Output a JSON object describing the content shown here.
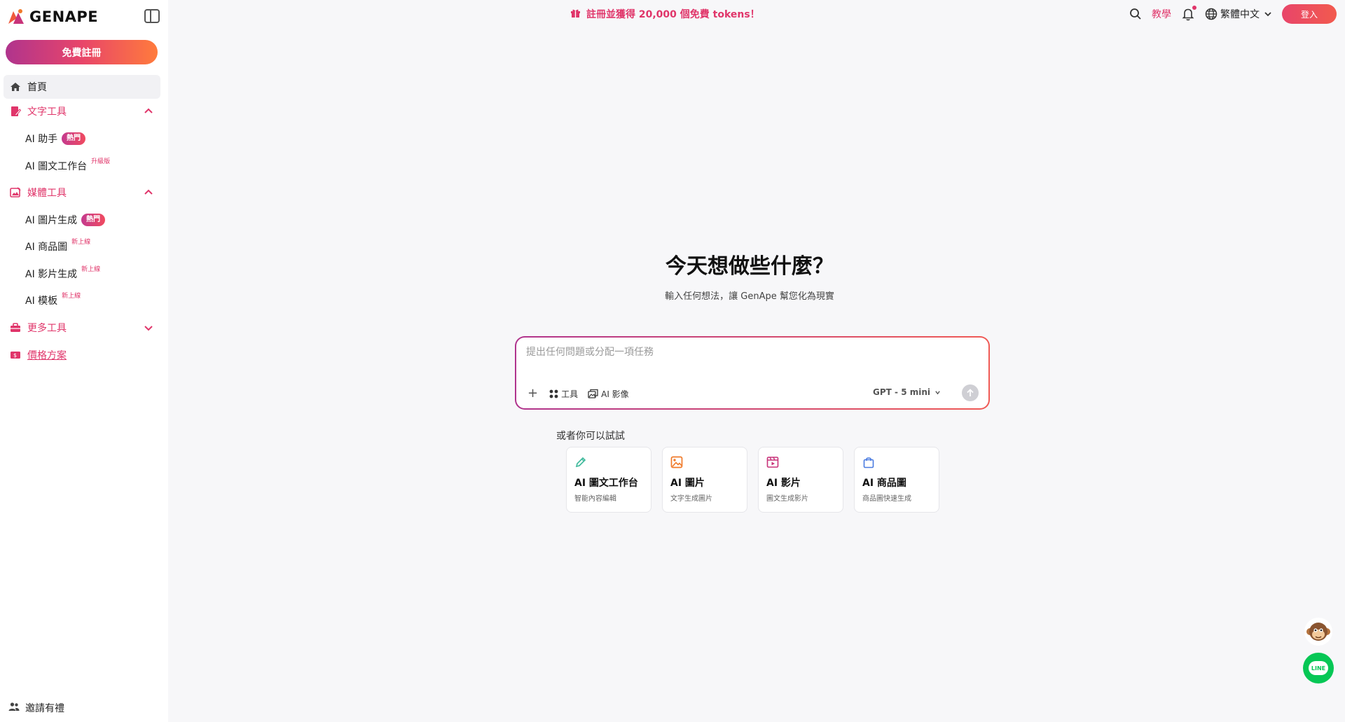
{
  "brand": {
    "name": "GENAPE",
    "accent": "#e0356a"
  },
  "sidebar": {
    "signup_label": "免費註冊",
    "home_label": "首頁",
    "sections": [
      {
        "label": "文字工具",
        "expanded": true,
        "items": [
          {
            "label": "AI 助手",
            "badge": "熱門",
            "badge_type": "hot"
          },
          {
            "label": "AI 圖文工作台",
            "badge": "升級版",
            "badge_type": "sup"
          }
        ]
      },
      {
        "label": "媒體工具",
        "expanded": true,
        "items": [
          {
            "label": "AI 圖片生成",
            "badge": "熱門",
            "badge_type": "hot"
          },
          {
            "label": "AI 商品圖",
            "badge": "新上線",
            "badge_type": "sup"
          },
          {
            "label": "AI 影片生成",
            "badge": "新上線",
            "badge_type": "sup"
          },
          {
            "label": "AI 模板",
            "badge": "新上線",
            "badge_type": "sup"
          }
        ]
      },
      {
        "label": "更多工具",
        "expanded": false,
        "items": []
      }
    ],
    "pricing_label": "價格方案",
    "invite_label": "邀請有禮"
  },
  "topbar": {
    "promo_text": "註冊並獲得 20,000 個免費 tokens！",
    "tutorial_label": "教學",
    "language": "繁體中文",
    "login_label": "登入"
  },
  "main": {
    "headline": "今天想做些什麼？",
    "subline": "輸入任何想法，讓 GenApe 幫您化為現實",
    "prompt_placeholder": "提出任何問題或分配一項任務",
    "tools_label": "工具",
    "ai_image_label": "AI 影像",
    "model": "GPT - 5 mini",
    "try_label": "或者你可以試試",
    "cards": [
      {
        "title": "AI 圖文工作台",
        "subtitle": "智能內容編輯",
        "icon": "pencil-icon",
        "color": "#3bb89a"
      },
      {
        "title": "AI 圖片",
        "subtitle": "文字生成圖片",
        "icon": "image-icon",
        "color": "#f07a2a"
      },
      {
        "title": "AI 影片",
        "subtitle": "圖文生成影片",
        "icon": "video-icon",
        "color": "#c8337a"
      },
      {
        "title": "AI 商品圖",
        "subtitle": "商品圖快速生成",
        "icon": "shopping-bag-icon",
        "color": "#4a7be0"
      }
    ]
  },
  "floating": {
    "line_label": "LINE"
  }
}
